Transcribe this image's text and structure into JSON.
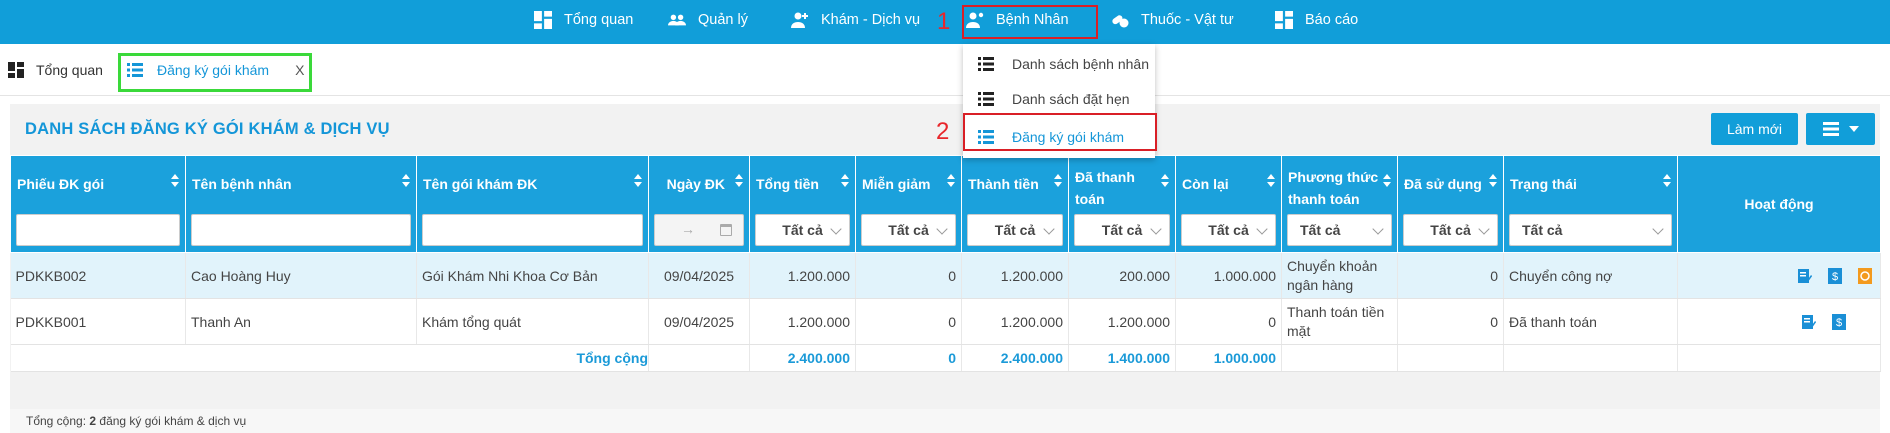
{
  "nav": {
    "items": [
      {
        "label": "Tổng quan",
        "icon": "dashboard-icon"
      },
      {
        "label": "Quản lý",
        "icon": "users-icon"
      },
      {
        "label": "Khám - Dịch vụ",
        "icon": "doctor-icon"
      },
      {
        "label": "Bệnh Nhân",
        "icon": "patient-icon"
      },
      {
        "label": "Thuốc - Vật tư",
        "icon": "medicine-icon"
      },
      {
        "label": "Báo cáo",
        "icon": "report-icon"
      }
    ],
    "annotation_1": "1",
    "annotation_2": "2"
  },
  "tabs": [
    {
      "label": "Tổng quan",
      "icon": "dashboard-icon"
    },
    {
      "label": "Đăng ký gói khám",
      "icon": "list-icon",
      "close": "X"
    }
  ],
  "dropdown": {
    "items": [
      {
        "label": "Danh sách bệnh nhân",
        "icon": "list-icon"
      },
      {
        "label": "Danh sách đặt hẹn",
        "icon": "list-icon"
      },
      {
        "label": "Đăng ký gói khám",
        "icon": "list-icon"
      }
    ]
  },
  "panel": {
    "title": "DANH SÁCH ĐĂNG KÝ GÓI KHÁM & DỊCH VỤ",
    "refresh_label": "Làm mới",
    "columns_button_icon": "list-icon"
  },
  "table": {
    "columns": [
      "Phiếu ĐK gói",
      "Tên bệnh nhân",
      "Tên gói khám ĐK",
      "Ngày ĐK",
      "Tổng tiền",
      "Miễn giảm",
      "Thành tiền",
      "Đã thanh toán",
      "Còn lại",
      "Phương thức thanh toán",
      "Đã sử dụng",
      "Trạng thái",
      "Hoạt động"
    ],
    "filter_all": "Tất cả",
    "date_arrow": "→",
    "rows": [
      {
        "code": "PDKKB002",
        "patient": "Cao Hoàng Huy",
        "package": "Gói Khám Nhi Khoa Cơ Bản",
        "date": "09/04/2025",
        "total": "1.200.000",
        "discount": "0",
        "amount": "1.200.000",
        "paid": "200.000",
        "remaining": "1.000.000",
        "method": "Chuyển khoản ngân hàng",
        "used": "0",
        "status": "Chuyển công nợ"
      },
      {
        "code": "PDKKB001",
        "patient": "Thanh An",
        "package": "Khám tổng quát",
        "date": "09/04/2025",
        "total": "1.200.000",
        "discount": "0",
        "amount": "1.200.000",
        "paid": "1.200.000",
        "remaining": "0",
        "method": "Thanh toán tiền mặt",
        "used": "0",
        "status": "Đã thanh toán"
      }
    ],
    "totals": {
      "label": "Tổng cộng",
      "total": "2.400.000",
      "discount": "0",
      "amount": "2.400.000",
      "paid": "1.400.000",
      "remaining": "1.000.000"
    }
  },
  "footer": {
    "prefix": "Tổng cộng: ",
    "count": "2",
    "suffix": " đăng ký gói khám & dịch vụ"
  },
  "colors": {
    "primary": "#119ed9",
    "header": "#1ba1dc",
    "title": "#1496d8",
    "highlight_row": "#e1f3fb",
    "annotation_red": "#d91f26",
    "annotation_green": "#3ad93a"
  }
}
